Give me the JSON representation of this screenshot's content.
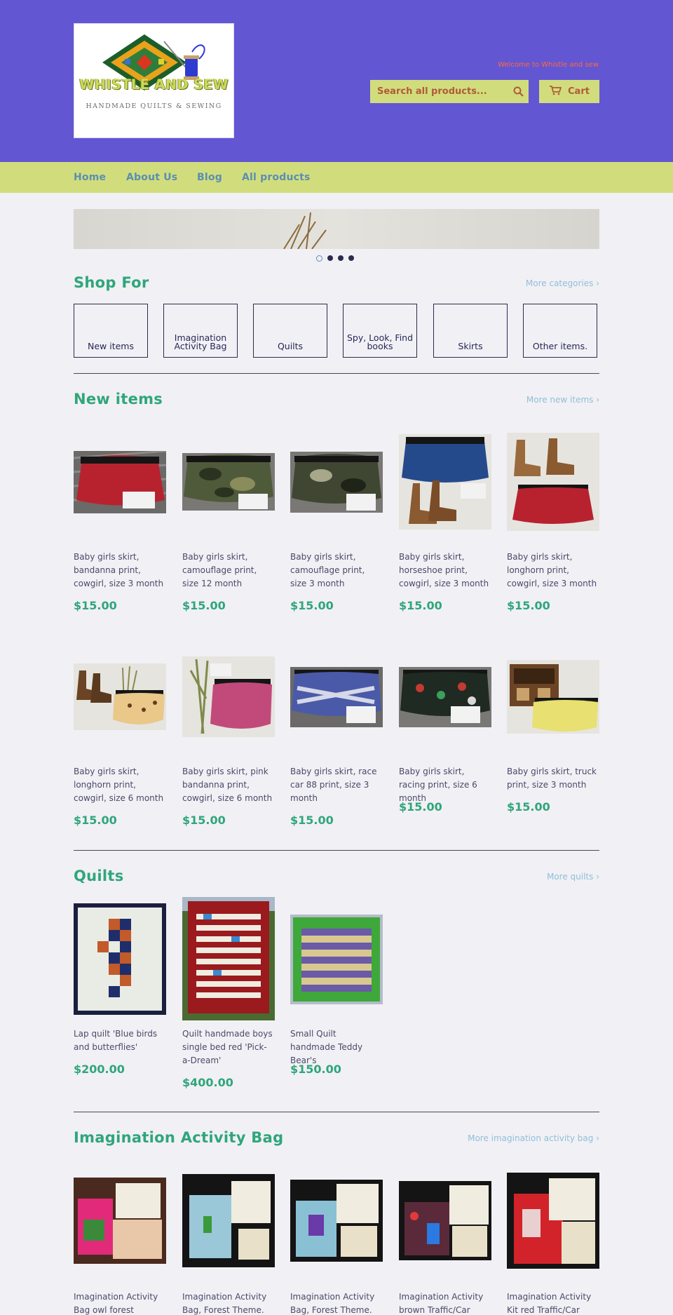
{
  "header": {
    "logo": {
      "title": "WHISTLE AND SEW",
      "subtitle": "HANDMADE QUILTS & SEWING"
    },
    "welcome": "Welcome to Whistle and sew",
    "search_placeholder": "Search all products...",
    "cart_label": "Cart"
  },
  "nav": {
    "items": [
      "Home",
      "About Us",
      "Blog",
      "All products"
    ]
  },
  "shop_for": {
    "title": "Shop For",
    "more": "More categories ›",
    "categories": [
      "New items",
      "Imagination Activity Bag",
      "Quilts",
      "Spy, Look, Find books",
      "Skirts",
      "Other items."
    ]
  },
  "new_items": {
    "title": "New items",
    "more": "More new items ›",
    "products": [
      {
        "title": "Baby girls skirt, bandanna print, cowgirl, size 3 month",
        "price": "$15.00"
      },
      {
        "title": "Baby girls skirt, camouflage print, size 12 month",
        "price": "$15.00"
      },
      {
        "title": "Baby girls skirt, camouflage print, size 3 month",
        "price": "$15.00"
      },
      {
        "title": "Baby girls skirt, horseshoe print, cowgirl, size 3 month",
        "price": "$15.00"
      },
      {
        "title": "Baby girls skirt, longhorn print, cowgirl, size 3 month",
        "price": "$15.00"
      },
      {
        "title": "Baby girls skirt, longhorn print, cowgirl, size 6 month",
        "price": "$15.00"
      },
      {
        "title": "Baby girls skirt, pink bandanna print, cowgirl, size 6 month",
        "price": "$15.00"
      },
      {
        "title": "Baby girls skirt, race car 88 print, size 3 month",
        "price": "$15.00"
      },
      {
        "title": "Baby girls skirt, racing print, size 6 month",
        "price": "$15.00"
      },
      {
        "title": "Baby girls skirt, truck print, size 3 month",
        "price": "$15.00"
      }
    ]
  },
  "quilts": {
    "title": "Quilts",
    "more": "More quilts ›",
    "products": [
      {
        "title": "Lap quilt 'Blue birds and butterflies'",
        "price": "$200.00"
      },
      {
        "title": "Quilt handmade boys single bed red 'Pick-a-Dream'",
        "price": "$400.00"
      },
      {
        "title": "Small Quilt handmade Teddy Bear's",
        "price": "$150.00"
      }
    ]
  },
  "activity_bag": {
    "title": "Imagination Activity Bag",
    "more": "More imagination activity bag ›",
    "products": [
      {
        "title": "Imagination Activity Bag owl forest theme."
      },
      {
        "title": "Imagination Activity Bag, Forest Theme."
      },
      {
        "title": "Imagination Activity Bag, Forest Theme."
      },
      {
        "title": "Imagination Activity brown Traffic/Car"
      },
      {
        "title": "Imagination Activity Kit red Traffic/Car"
      }
    ]
  },
  "colors": {
    "header_bg": "#6356d2",
    "accent": "#d1dd7d",
    "price": "#2fa67a",
    "link": "#5b8fb0"
  }
}
